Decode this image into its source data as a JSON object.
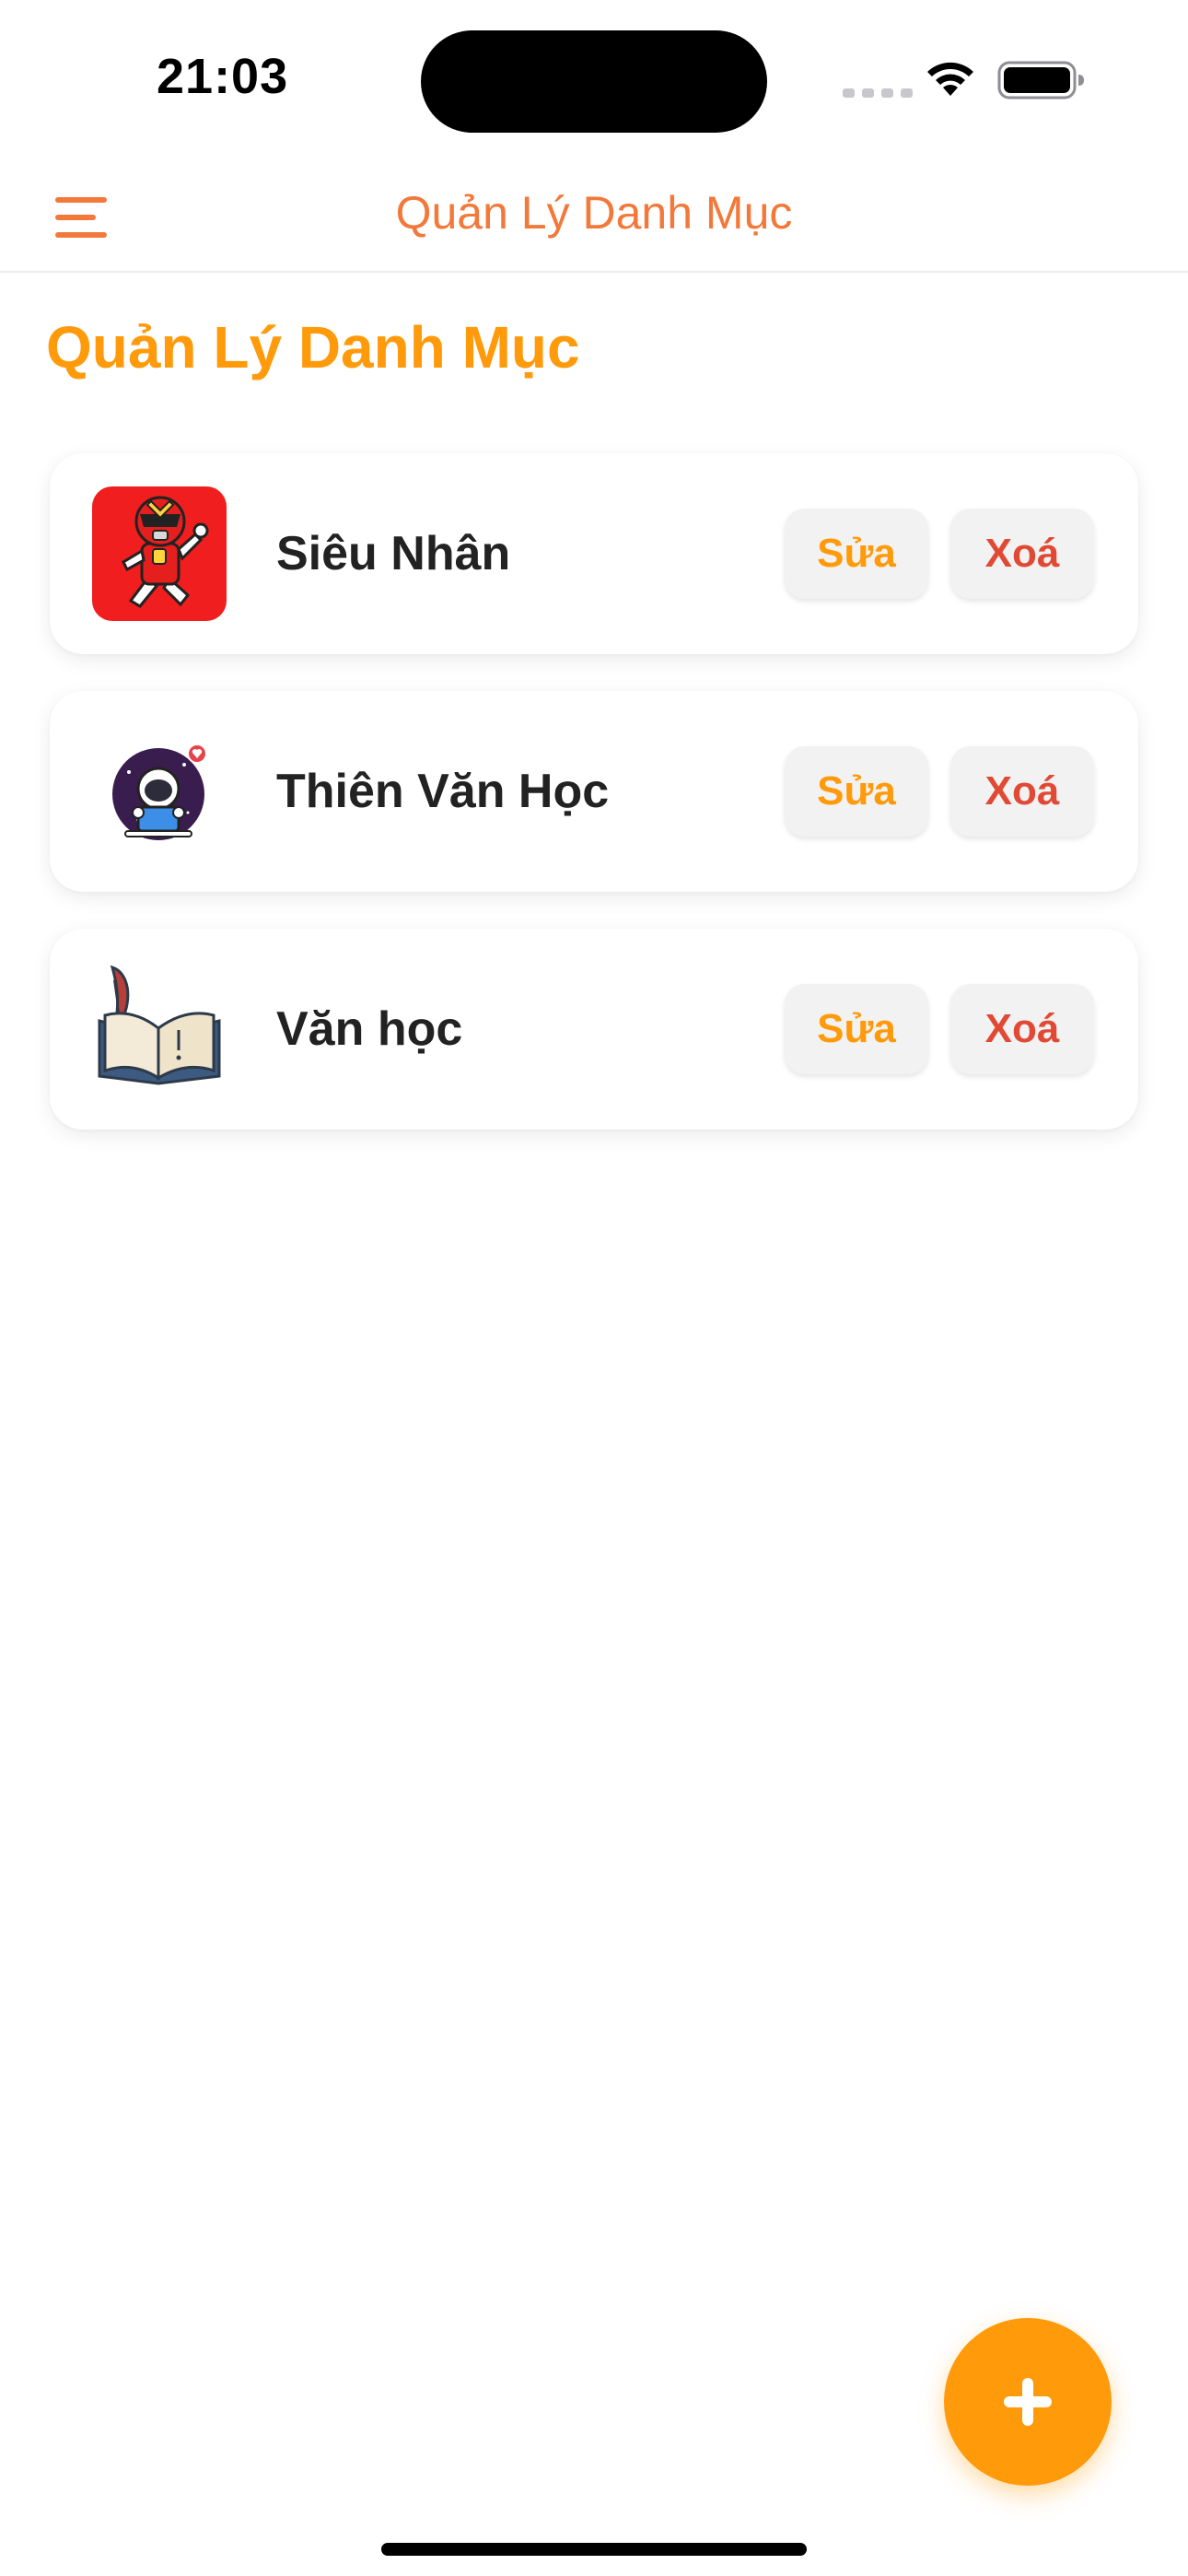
{
  "status_bar": {
    "time": "21:03"
  },
  "navbar": {
    "title": "Quản Lý Danh Mục",
    "menu_icon": "hamburger-menu-icon"
  },
  "page": {
    "title": "Quản Lý Danh Mục"
  },
  "categories": [
    {
      "name": "Siêu Nhân",
      "icon": "power-ranger-thumbnail",
      "edit_label": "Sửa",
      "delete_label": "Xoá"
    },
    {
      "name": "Thiên Văn Học",
      "icon": "astronaut-thumbnail",
      "edit_label": "Sửa",
      "delete_label": "Xoá"
    },
    {
      "name": "Văn học",
      "icon": "open-book-quill-thumbnail",
      "edit_label": "Sửa",
      "delete_label": "Xoá"
    }
  ],
  "fab": {
    "icon": "plus-icon"
  },
  "colors": {
    "accent": "#ff9a0a",
    "nav_accent": "#f2793a",
    "delete": "#e04a35",
    "button_bg": "#f2f2f2"
  }
}
